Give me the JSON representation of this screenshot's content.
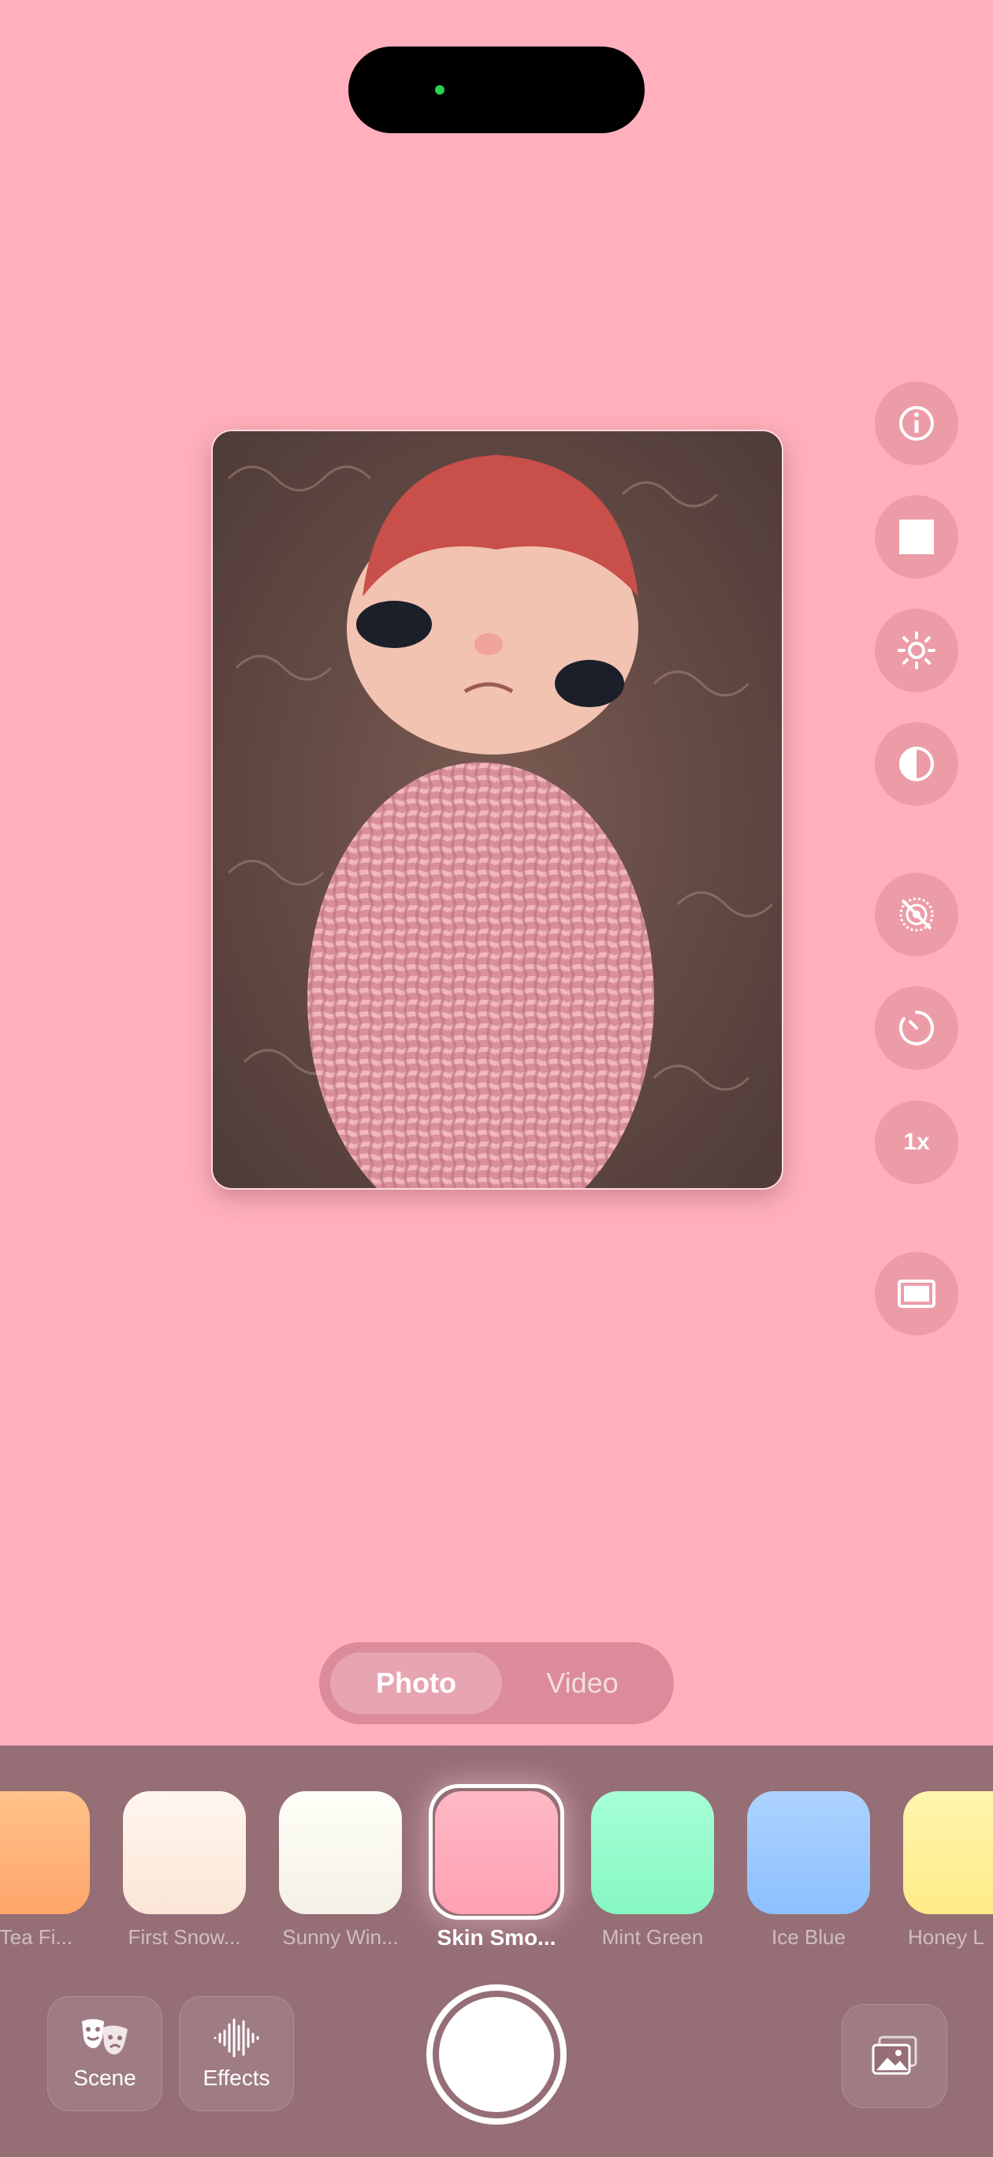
{
  "modes": {
    "photo": "Photo",
    "video": "Video",
    "active": "Photo"
  },
  "side_controls": [
    {
      "icon": "info-icon"
    },
    {
      "icon": "aspect-square-icon"
    },
    {
      "icon": "brightness-icon"
    },
    {
      "icon": "contrast-icon"
    },
    {
      "icon": "live-off-icon"
    },
    {
      "icon": "timer-icon"
    },
    {
      "icon": "zoom-icon",
      "label": "1x"
    },
    {
      "icon": "frame-icon"
    }
  ],
  "filters": [
    {
      "label": "k Tea Fi...",
      "color": "#ffb27a"
    },
    {
      "label": "First Snow...",
      "color": "#fdeee2"
    },
    {
      "label": "Sunny Win...",
      "color": "#fbfaf3"
    },
    {
      "label": "Skin Smo...",
      "color": "#ffa8b8",
      "selected": true
    },
    {
      "label": "Mint Green",
      "color": "#98ffce"
    },
    {
      "label": "Ice Blue",
      "color": "#9dcaff"
    },
    {
      "label": "Honey L",
      "color": "#fff19a"
    }
  ],
  "tools": {
    "scene": "Scene",
    "effects": "Effects"
  },
  "colors": {
    "background": "#ffb0bc",
    "panel": "#956e76"
  }
}
